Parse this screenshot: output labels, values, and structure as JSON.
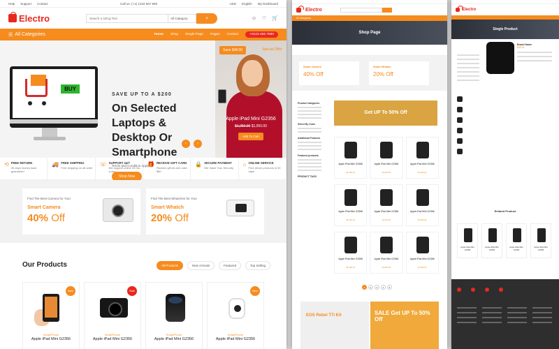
{
  "colors": {
    "accent": "#f68b1e",
    "brand_red": "#e8281f",
    "sale_badge": "#e8281f",
    "new_badge": "#f68b1e"
  },
  "main": {
    "topbar": {
      "links": [
        "Help",
        "Support",
        "Contact"
      ],
      "phone": "Call us: (+1) 1234 567 890",
      "currency": "USD",
      "language": "English",
      "wishlist": "My Dashboard"
    },
    "logo": "Electro",
    "search": {
      "placeholder": "Search a string Text",
      "category": "All Category"
    },
    "nav": {
      "all_categories": "All Categories",
      "links": [
        "Home",
        "Shop",
        "Single Page",
        "Pages",
        "Contact"
      ],
      "phone": "+0123 456 7890"
    },
    "hero": {
      "save_line": "SAVE UP TO A $200",
      "title": "On Selected Laptops & Desktop Or Smartphone",
      "terms": "Terms and Condition Apply",
      "shop_button": "Shop Now",
      "screen_button": "BUY",
      "side": {
        "save_badge": "Save $48.00",
        "offer": "Special Offer",
        "name": "Apple iPad Mini G2356",
        "old_price": "$1,250.00",
        "price": "$1,050.00",
        "cart": "Add To Cart"
      }
    },
    "features": [
      {
        "icon": "return-icon",
        "glyph": "⟲",
        "title": "FREE RETURN",
        "text": "30 days money back guarantee!"
      },
      {
        "icon": "truck-icon",
        "glyph": "🚚",
        "title": "FREE SHIPPING",
        "text": "Free shipping on all order"
      },
      {
        "icon": "headset-icon",
        "glyph": "☏",
        "title": "SUPPORT 24/7",
        "text": "We support online 24 hrs a day"
      },
      {
        "icon": "gift-icon",
        "glyph": "🎁",
        "title": "RECEIVE GIFT CARD",
        "text": "Recieve gift all over oder $50"
      },
      {
        "icon": "lock-icon",
        "glyph": "🔒",
        "title": "SECURE PAYMENT",
        "text": "We Value Your Security"
      },
      {
        "icon": "store-icon",
        "glyph": "⌂",
        "title": "ONLINE SERVICE",
        "text": "Free return products in 30 days"
      }
    ],
    "promos": [
      {
        "head": "Find The Best Camera for You!",
        "title": "Smart Camera",
        "percent": "40%",
        "off": "Off"
      },
      {
        "head": "Find The Best Whatches for You!",
        "title": "Smart Whatch",
        "percent": "20%",
        "off": "Off"
      }
    ],
    "products": {
      "title": "Our Products",
      "tabs": [
        "All Products",
        "New Arrivals",
        "Featured",
        "Top Selling"
      ],
      "items": [
        {
          "badge": "New",
          "tag": "SmartPhone",
          "name": "Apple iPad Mini G2356"
        },
        {
          "badge": "Sale",
          "tag": "SmartPhone",
          "name": "Apple iPad Mini G2356"
        },
        {
          "badge": "",
          "tag": "SmartPhone",
          "name": "Apple iPad Mini G2356"
        },
        {
          "badge": "New",
          "tag": "SmartPhone",
          "name": "Apple iPad Mini G2356"
        }
      ]
    }
  },
  "mid": {
    "logo": "Electro",
    "nav": "All Categories",
    "banner": "Shop Page",
    "promos": [
      {
        "title": "Smart Camera",
        "value": "40% Off"
      },
      {
        "title": "Smart Whatch",
        "value": "20% Off"
      }
    ],
    "sidebar": [
      "Product Categories",
      "Select By Color",
      "Additional Products",
      "Featured products",
      "PRODUCT TAGS"
    ],
    "sale_banner": "Get UP To 50% Off",
    "grid_item": {
      "name": "Apple iPad Mini G2356",
      "price": "$1,050.00"
    },
    "pages": [
      "1",
      "2",
      "3",
      "4",
      "5"
    ],
    "bottom_left": "EOS Rebel T7i Kit",
    "bottom_right": "SALE Get UP To 50% Off"
  },
  "right": {
    "logo": "Electro",
    "banner": "Single Product",
    "detail_name": "Brand Name",
    "detail_price": "$30.00",
    "related": "Related Product",
    "related_item": "Apple iPad Mini G2356"
  }
}
